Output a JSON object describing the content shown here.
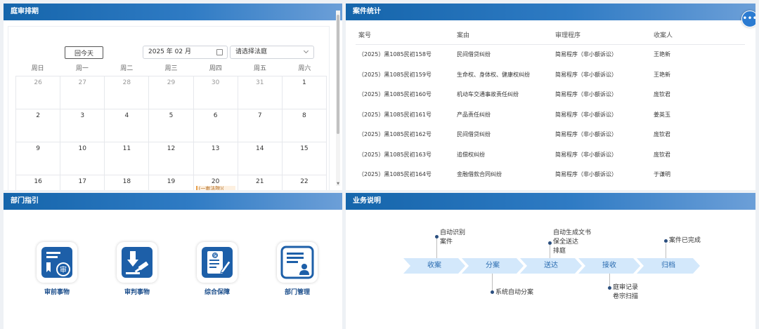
{
  "schedule": {
    "title": "庭审排期",
    "today_label": "回今天",
    "month_value": "2025 年 02 月",
    "court_placeholder": "请选择法庭",
    "weekdays": [
      "周日",
      "周一",
      "周二",
      "周三",
      "周四",
      "周五",
      "周六"
    ],
    "weeks": [
      [
        "26",
        "27",
        "28",
        "29",
        "30",
        "31",
        "1"
      ],
      [
        "2",
        "3",
        "4",
        "5",
        "6",
        "7",
        "8"
      ],
      [
        "9",
        "10",
        "11",
        "12",
        "13",
        "14",
        "15"
      ],
      [
        "16",
        "17",
        "18",
        "19",
        "20",
        "21",
        "22"
      ]
    ],
    "event_label": "(一审法院)("
  },
  "cases": {
    "title": "案件统计",
    "columns": [
      "案号",
      "案由",
      "审理程序",
      "收案人"
    ],
    "rows": [
      [
        "（2025）黑1085民初158号",
        "民间借贷纠纷",
        "简易程序（非小额诉讼）",
        "王艳新"
      ],
      [
        "（2025）黑1085民初159号",
        "生命权、身体权、健康权纠纷",
        "简易程序（非小额诉讼）",
        "王艳新"
      ],
      [
        "（2025）黑1085民初160号",
        "机动车交通事故责任纠纷",
        "简易程序（非小额诉讼）",
        "庞钦君"
      ],
      [
        "（2025）黑1085民初161号",
        "产品责任纠纷",
        "简易程序（非小额诉讼）",
        "姜英玉"
      ],
      [
        "（2025）黑1085民初162号",
        "民间借贷纠纷",
        "简易程序（非小额诉讼）",
        "庞钦君"
      ],
      [
        "（2025）黑1085民初163号",
        "追偿权纠纷",
        "简易程序（非小额诉讼）",
        "庞钦君"
      ],
      [
        "（2025）黑1085民初164号",
        "金融借款合同纠纷",
        "简易程序（非小额诉讼）",
        "于谦明"
      ]
    ]
  },
  "dept": {
    "title": "部门指引",
    "items": [
      {
        "label": "审前事物",
        "icon": "pretrial-icon",
        "badge": "审"
      },
      {
        "label": "审判事物",
        "icon": "gavel-icon"
      },
      {
        "label": "综合保障",
        "icon": "support-document-icon",
        "badge": "保"
      },
      {
        "label": "部门管理",
        "icon": "department-management-icon"
      }
    ]
  },
  "business": {
    "title": "业务说明",
    "steps": [
      "收案",
      "分案",
      "送达",
      "接收",
      "归档"
    ],
    "notes": {
      "auto_identify_1": "自动识别",
      "auto_identify_2": "案件",
      "auto_assign": "系统自动分案",
      "auto_doc": "自动生成文书",
      "preserve": "保全送达",
      "schedule": "排庭",
      "record_1": "庭审记录",
      "record_2": "卷宗扫描",
      "finished": "案件已完成"
    }
  },
  "colors": {
    "header_start": "#1565ab",
    "header_end": "#6c9fd8",
    "flow_fill": "#d3e8fb",
    "accent": "#2b7bd1"
  }
}
